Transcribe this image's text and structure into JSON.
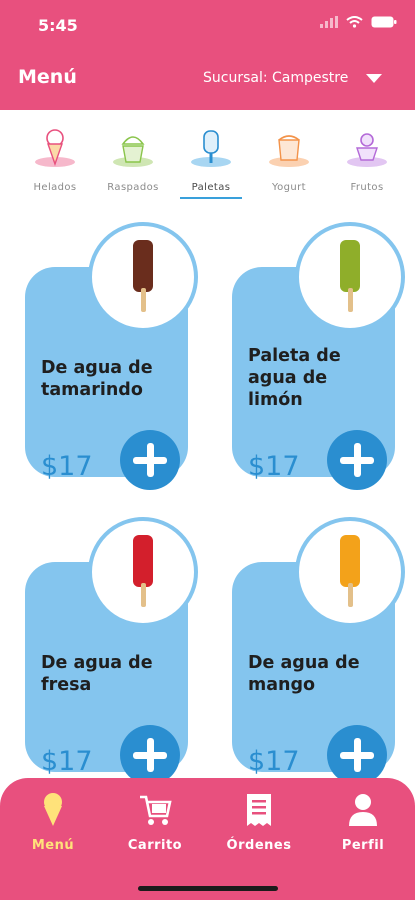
{
  "status": {
    "time": "5:45"
  },
  "header": {
    "title": "Menú",
    "branch_label": "Sucursal: Campestre"
  },
  "categories": [
    {
      "label": "Helados",
      "icon": "ice-cream-cone-icon",
      "color": "#e8507e"
    },
    {
      "label": "Raspados",
      "icon": "shaved-ice-icon",
      "color": "#8ac54b"
    },
    {
      "label": "Paletas",
      "icon": "popsicle-icon",
      "color": "#39a0db",
      "active": true
    },
    {
      "label": "Yogurt",
      "icon": "yogurt-icon",
      "color": "#f3934a"
    },
    {
      "label": "Frutos",
      "icon": "fruit-icon",
      "color": "#b46ad8"
    }
  ],
  "products": [
    {
      "name": "De agua de tamarindo",
      "price": "$17",
      "popsicle_color": "#6a2d1d"
    },
    {
      "name": "Paleta de agua de limón",
      "price": "$17",
      "popsicle_color": "#8fae2a"
    },
    {
      "name": "De agua de fresa",
      "price": "$17",
      "popsicle_color": "#d31f2c"
    },
    {
      "name": "De agua de mango",
      "price": "$17",
      "popsicle_color": "#f3a21a"
    }
  ],
  "nav": [
    {
      "label": "Menú",
      "icon": "ice-cream-cone-icon",
      "active": true
    },
    {
      "label": "Carrito",
      "icon": "shopping-cart-icon"
    },
    {
      "label": "Órdenes",
      "icon": "receipt-icon"
    },
    {
      "label": "Perfil",
      "icon": "user-icon"
    }
  ],
  "colors": {
    "brand_pink": "#e8507e",
    "card_blue": "#84c5ee",
    "accent_blue": "#2a8ed0",
    "active_nav": "#ffe27a"
  }
}
